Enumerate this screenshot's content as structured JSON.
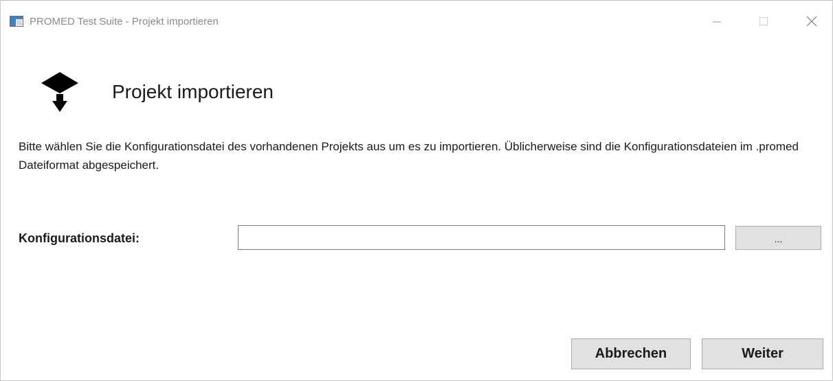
{
  "window": {
    "title": "PROMED Test Suite - Projekt importieren"
  },
  "header": {
    "icon": "import-arrow-icon",
    "title": "Projekt importieren"
  },
  "description": "Bitte wählen Sie die Konfigurationsdatei des vorhandenen Projekts aus um es zu importieren. Üblicherweise sind die Konfigurationsdateien im .promed Dateiformat abgespeichert.",
  "config_file": {
    "label": "Konfigurationsdatei:",
    "value": "",
    "browse_label": "..."
  },
  "actions": {
    "cancel_label": "Abbrechen",
    "next_label": "Weiter"
  },
  "colors": {
    "button_bg": "#e1e1e1",
    "button_border": "#adadad",
    "title_text": "#8a8a8a"
  }
}
